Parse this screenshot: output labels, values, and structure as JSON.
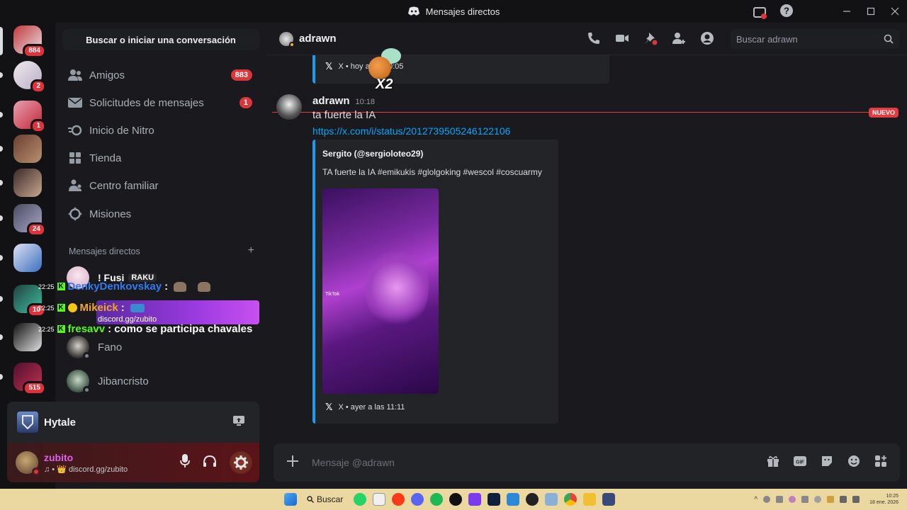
{
  "window": {
    "title": "Mensajes directos"
  },
  "servers": [
    {
      "badge": "884",
      "colors": [
        "#c0383c",
        "#e8e0e0"
      ]
    },
    {
      "badge": "2",
      "colors": [
        "#f0e8ec",
        "#b8b0c8"
      ]
    },
    {
      "badge": "1",
      "colors": [
        "#e8a0b0",
        "#c02838"
      ]
    },
    {
      "badge": "",
      "colors": [
        "#6a4030",
        "#b89070"
      ]
    },
    {
      "badge": "",
      "colors": [
        "#3a2828",
        "#c8a890"
      ]
    },
    {
      "badge": "24",
      "colors": [
        "#4a4a60",
        "#a8a8c8"
      ]
    },
    {
      "badge": "",
      "colors": [
        "#e0e0f0",
        "#3870c0"
      ]
    },
    {
      "badge": "10",
      "colors": [
        "#204040",
        "#40c0a0"
      ]
    },
    {
      "badge": "",
      "colors": [
        "#101010",
        "#e0e0e0"
      ]
    },
    {
      "badge": "515",
      "colors": [
        "#501030",
        "#c03050"
      ]
    }
  ],
  "dm_search": "Buscar o iniciar una conversación",
  "nav": [
    {
      "label": "Amigos",
      "count": "883",
      "icon": "friends-icon"
    },
    {
      "label": "Solicitudes de mensajes",
      "count": "1",
      "icon": "mail-icon"
    },
    {
      "label": "Inicio de Nitro",
      "count": "",
      "icon": "nitro-icon"
    },
    {
      "label": "Tienda",
      "count": "",
      "icon": "shop-icon"
    },
    {
      "label": "Centro familiar",
      "count": "",
      "icon": "family-icon"
    },
    {
      "label": "Misiones",
      "count": "",
      "icon": "quests-icon"
    }
  ],
  "dm_header": "Mensajes directos",
  "dm_header_add": "+",
  "dms": [
    {
      "name": "Fano"
    },
    {
      "name": "Jibancristo"
    }
  ],
  "dm_top_names": {
    "first": "! Fusi",
    "tag": "RAKU",
    "second_sub": "discord.gg/zubito"
  },
  "overlay_chat": [
    {
      "time": "22:25",
      "user": "DenkyDenkovskay",
      "text": ":",
      "color": "#2e7bf0"
    },
    {
      "time": "22:25",
      "user": "Mikeick",
      "text": ":",
      "color": "#f5a623"
    },
    {
      "time": "22:25",
      "user": "fresavv",
      "text": ": como se participa chavales",
      "color": "#53fc18"
    }
  ],
  "game_activity": {
    "name": "Hytale"
  },
  "user": {
    "name": "zubito",
    "status": "♫ • 👑 discord.gg/zubito"
  },
  "channel": {
    "name": "adrawn",
    "search_placeholder": "Buscar adrawn"
  },
  "prev_embed": {
    "footer": "X • hoy a las 10:05"
  },
  "new_tag": "NUEVO",
  "message": {
    "author": "adrawn",
    "time": "10:18",
    "text": "ta fuerte la IA",
    "link": "https://x.com/i/status/2012739505246122106",
    "embed_author": "Sergito (@sergioloteo29)",
    "embed_text": "TA fuerte la IA #emikukis #glolgoking #wescol #coscuarmy",
    "embed_footer": "X • ayer a las 11:11",
    "video_label": "TikTok"
  },
  "message_box_placeholder": "Mensaje @adrawn",
  "overlay_x2": "X2",
  "taskbar": {
    "search": "Buscar",
    "clock_time": "10:25",
    "clock_date": "18 ene. 2026"
  }
}
